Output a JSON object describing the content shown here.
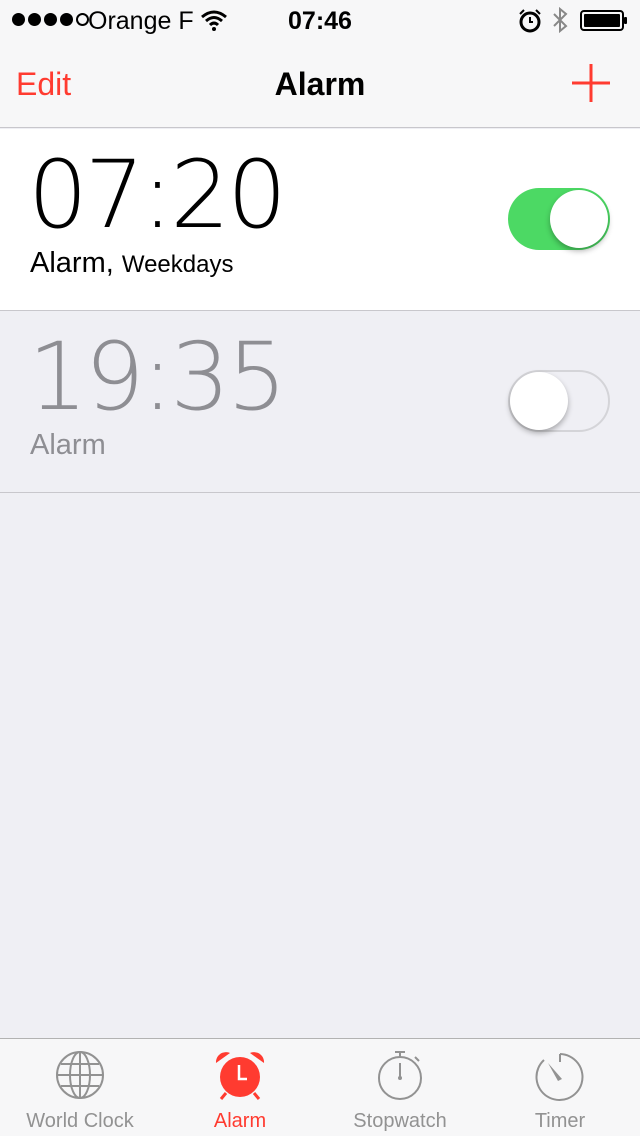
{
  "status_bar": {
    "carrier": "Orange F",
    "time": "07:46",
    "signal_bars_filled": 4,
    "signal_bars_total": 5,
    "icons": [
      "wifi-icon",
      "alarm-clock-icon",
      "bluetooth-icon",
      "battery-icon"
    ]
  },
  "nav": {
    "edit_label": "Edit",
    "title": "Alarm",
    "add_icon": "plus-icon"
  },
  "alarms": [
    {
      "time": "07:20",
      "label": "Alarm,",
      "repeat": "Weekdays",
      "enabled": true
    },
    {
      "time": "19:35",
      "label": "Alarm",
      "repeat": "",
      "enabled": false
    }
  ],
  "tabs": [
    {
      "label": "World Clock",
      "icon": "globe-icon",
      "active": false
    },
    {
      "label": "Alarm",
      "icon": "alarm-clock-icon",
      "active": true
    },
    {
      "label": "Stopwatch",
      "icon": "stopwatch-icon",
      "active": false
    },
    {
      "label": "Timer",
      "icon": "timer-icon",
      "active": false
    }
  ],
  "colors": {
    "accent": "#ff3b30",
    "toggle_on": "#4cd964",
    "inactive_text": "#8e8e93",
    "background": "#efeff4"
  }
}
